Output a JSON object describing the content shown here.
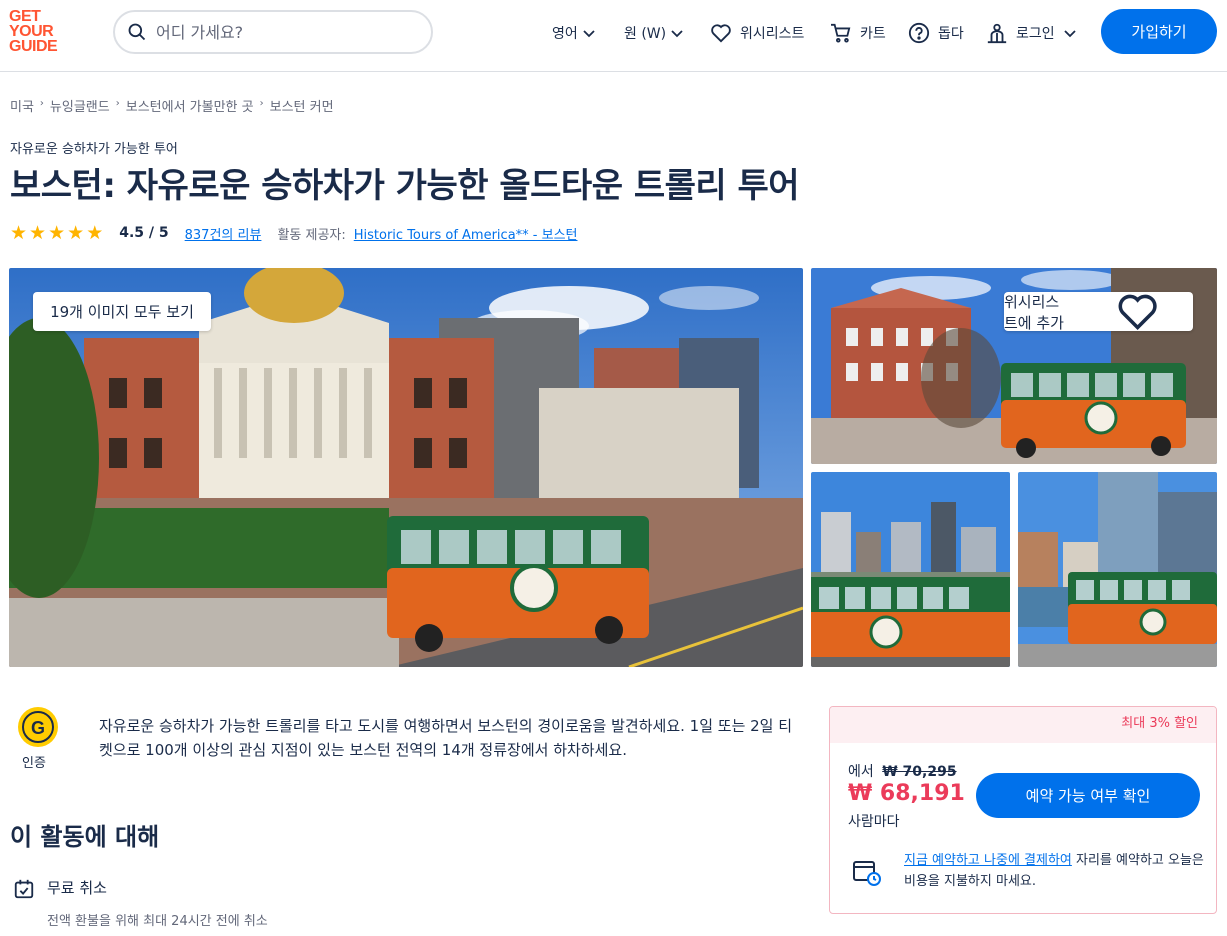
{
  "header": {
    "logo_lines": [
      "GET",
      "YOUR",
      "GUIDE"
    ],
    "search_placeholder": "어디 가세요?",
    "language": "영어",
    "currency": "원 (W)",
    "wishlist": "위시리스트",
    "cart": "카트",
    "help": "돕다",
    "login": "로그인",
    "signup": "가입하기"
  },
  "breadcrumb": [
    "미국",
    "뉴잉글랜드",
    "보스턴에서 가볼만한 곳",
    "보스턴 커먼"
  ],
  "activity": {
    "category": "자유로운 승하차가 가능한 투어",
    "title": "보스턴: 자유로운 승하차가 가능한 올드타운 트롤리 투어",
    "stars": 4.5,
    "rating": "4.5 / 5",
    "reviews": "837건의 리뷰",
    "provider_label": "활동 제공자:",
    "provider": "Historic Tours of America** - 보스턴"
  },
  "gallery": {
    "view_all": "19개 이미지 모두 보기",
    "add_wishlist": "위시리스트에 추가"
  },
  "badge": {
    "label": "인증",
    "letter": "G"
  },
  "description": "자유로운 승하차가 가능한 트롤리를 타고 도시를 여행하면서 보스턴의 경이로움을 발견하세요. 1일 또는 2일 티켓으로 100개 이상의 관심 지점이 있는 보스턴 전역의 14개 정류장에서 하차하세요.",
  "about": {
    "title": "이 활동에 대해",
    "features": [
      {
        "title": "무료 취소",
        "subtitle": "전액 환불을 위해 최대 24시간 전에 취소"
      }
    ]
  },
  "booking": {
    "discount": "최대 3% 할인",
    "from_label": "에서",
    "original_price": "₩ 70,295",
    "price": "₩ 68,191",
    "per_person": "사람마다",
    "check_button": "예약 가능 여부 확인",
    "reserve_link": "지금 예약하고 나중에 결제하여",
    "reserve_text": " 자리를 예약하고 오늘은 비용을 지불하지 마세요."
  },
  "colors": {
    "brand": "#ff5533",
    "primary": "#0071eb",
    "text": "#1a2b49",
    "sale": "#eb3b5a",
    "star": "#ffb400"
  }
}
